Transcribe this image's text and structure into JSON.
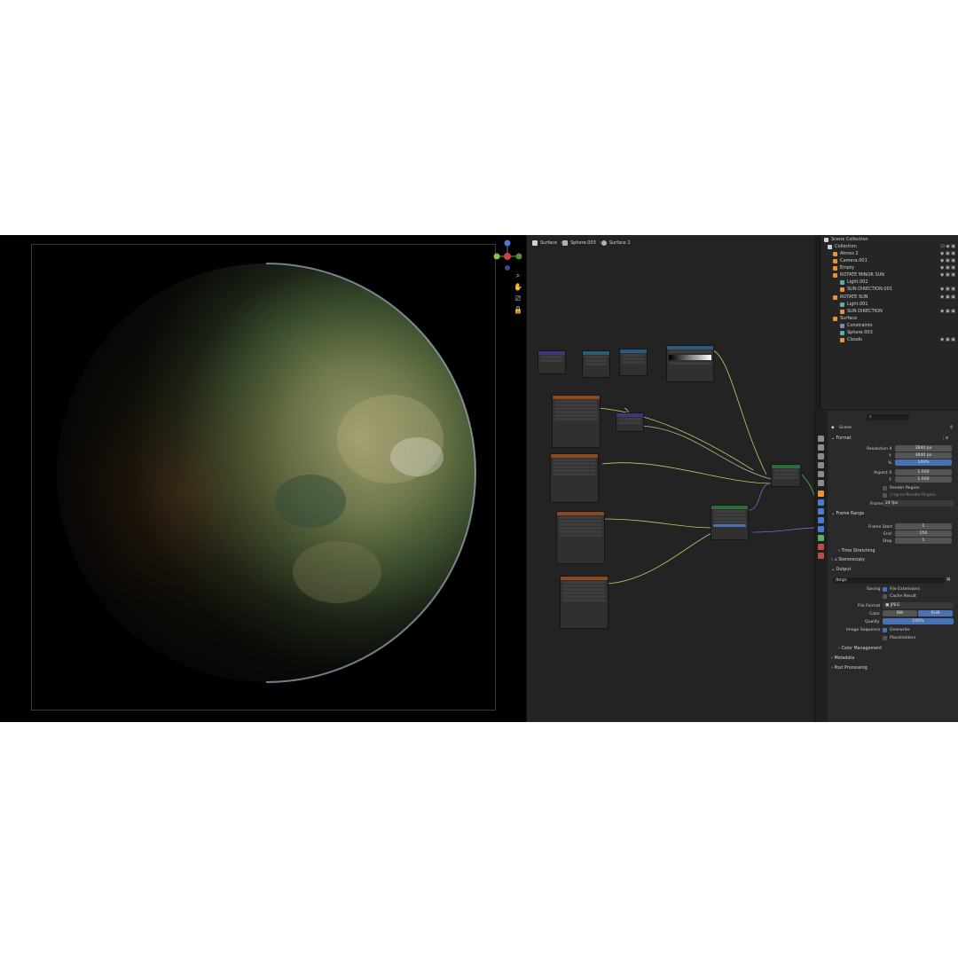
{
  "node_editor": {
    "breadcrumb": [
      "Surface",
      "Sphere.003",
      "Surface 2"
    ]
  },
  "outliner": {
    "items": [
      {
        "label": "Scene Collection",
        "indent": 0
      },
      {
        "label": "Collection",
        "indent": 1
      },
      {
        "label": "Atmos 2",
        "indent": 2
      },
      {
        "label": "Camera.001",
        "indent": 2
      },
      {
        "label": "Empty",
        "indent": 2
      },
      {
        "label": "ROTATE MINOR SUN",
        "indent": 2
      },
      {
        "label": "Light.002",
        "indent": 3
      },
      {
        "label": "SUN DIRECTION.001",
        "indent": 3
      },
      {
        "label": "ROTATE SUN",
        "indent": 2
      },
      {
        "label": "Light.001",
        "indent": 3
      },
      {
        "label": "SUN DIRECTION",
        "indent": 3
      },
      {
        "label": "Surface",
        "indent": 2
      },
      {
        "label": "Constraints",
        "indent": 3
      },
      {
        "label": "Sphere.003",
        "indent": 3
      },
      {
        "label": "Clouds",
        "indent": 3
      }
    ]
  },
  "properties": {
    "scene_label": "Scene",
    "format": {
      "header": "Format",
      "resolution_x_label": "Resolution X",
      "resolution_x": "3840 px",
      "y_label": "Y",
      "resolution_y": "3840 px",
      "pct_label": "%",
      "pct": "100%",
      "aspect_x_label": "Aspect X",
      "aspect_x": "1.000",
      "aspect_y_label": "Y",
      "aspect_y": "1.000",
      "render_region": "Render Region",
      "crop_region": "Crop to Render Region",
      "frame_rate_label": "Frame Rate",
      "frame_rate": "24 fps"
    },
    "frame_range": {
      "header": "Frame Range",
      "start_label": "Frame Start",
      "start": "1",
      "end_label": "End",
      "end": "250",
      "step_label": "Step",
      "step": "1",
      "time_stretching": "Time Stretching",
      "stereoscopy": "Stereoscopy"
    },
    "output": {
      "header": "Output",
      "path": "/tmp\\",
      "saving_label": "Saving",
      "file_extensions": "File Extensions",
      "cache_result": "Cache Result",
      "file_format_label": "File Format",
      "file_format": "JPEG",
      "color_label": "Color",
      "color_bw": "BW",
      "color_rgb": "RGB",
      "quality_label": "Quality",
      "quality": "100%",
      "image_sequence_label": "Image Sequence",
      "overwrite": "Overwrite",
      "placeholders": "Placeholders",
      "color_management": "Color Management"
    },
    "metadata": "Metadata",
    "post_processing": "Post Processing"
  },
  "colors": {
    "accent": "#4772b3",
    "node_tex": "#8a4a1e",
    "node_vec": "#3a3a7a",
    "node_conv": "#2e5a7a",
    "node_shader": "#2e6a3a"
  }
}
